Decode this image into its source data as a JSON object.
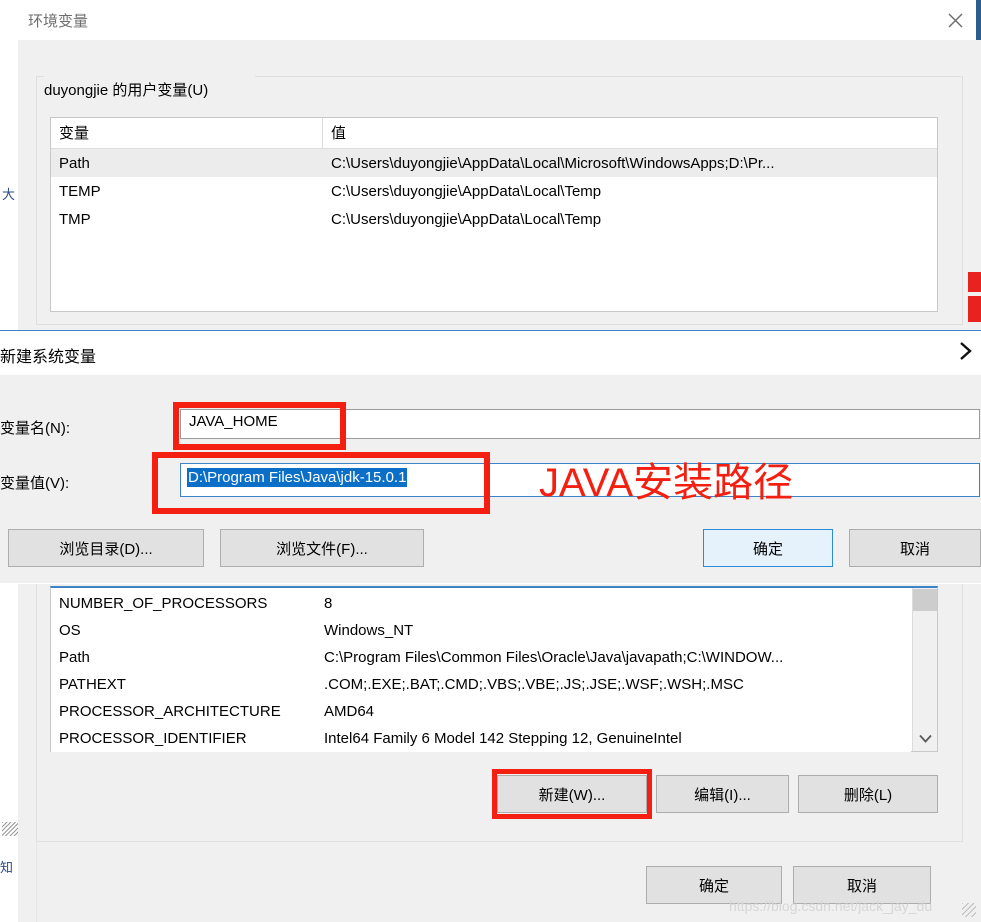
{
  "outer_dialog": {
    "title": "环境变量",
    "close_icon": "close-icon",
    "user_group_label": "duyongjie 的用户变量(U)",
    "user_table": {
      "headers": [
        "变量",
        "值"
      ],
      "rows": [
        {
          "name": "Path",
          "value": "C:\\Users\\duyongjie\\AppData\\Local\\Microsoft\\WindowsApps;D:\\Pr...",
          "selected": true
        },
        {
          "name": "TEMP",
          "value": "C:\\Users\\duyongjie\\AppData\\Local\\Temp",
          "selected": false
        },
        {
          "name": "TMP",
          "value": "C:\\Users\\duyongjie\\AppData\\Local\\Temp",
          "selected": false
        }
      ]
    },
    "system_table": {
      "rows": [
        {
          "name": "NUMBER_OF_PROCESSORS",
          "value": "8"
        },
        {
          "name": "OS",
          "value": "Windows_NT"
        },
        {
          "name": "Path",
          "value": "C:\\Program Files\\Common Files\\Oracle\\Java\\javapath;C:\\WINDOW..."
        },
        {
          "name": "PATHEXT",
          "value": ".COM;.EXE;.BAT;.CMD;.VBS;.VBE;.JS;.JSE;.WSF;.WSH;.MSC"
        },
        {
          "name": "PROCESSOR_ARCHITECTURE",
          "value": "AMD64"
        },
        {
          "name": "PROCESSOR_IDENTIFIER",
          "value": "Intel64 Family 6 Model 142 Stepping 12, GenuineIntel"
        }
      ]
    },
    "system_buttons": {
      "new": "新建(W)...",
      "edit": "编辑(I)...",
      "delete": "删除(L)"
    },
    "footer_buttons": {
      "ok": "确定",
      "cancel": "取消"
    },
    "scrollbar_down_icon": "chevron-down-icon"
  },
  "inner_dialog": {
    "title": "新建系统变量",
    "close_icon": "chevron-right-icon",
    "name_label": "变量名(N):",
    "value_label": "变量值(V):",
    "name_value": "JAVA_HOME",
    "value_value": "D:\\Program Files\\Java\\jdk-15.0.1",
    "browse_dir": "浏览目录(D)...",
    "browse_file": "浏览文件(F)...",
    "ok": "确定",
    "cancel": "取消"
  },
  "annotations": {
    "java_path_note": "JAVA安装路径",
    "highlight_color": "#f41f10"
  },
  "watermark": "https://blog.csdn.net/jack_jay_du"
}
